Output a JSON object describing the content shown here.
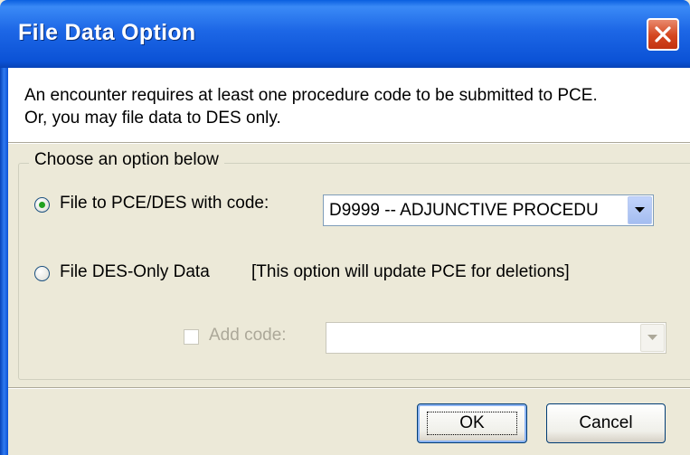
{
  "window": {
    "title": "File Data Option"
  },
  "message": {
    "line1": "An encounter requires at least one procedure code to be submitted to PCE.",
    "line2": "Or, you may file data to DES only."
  },
  "options_group": {
    "label": "Choose an option below",
    "option1": {
      "label": "File to PCE/DES with code:",
      "selected": true,
      "combo_value": "D9999 -- ADJUNCTIVE PROCEDU"
    },
    "option2": {
      "label": "File DES-Only Data",
      "note": "[This option will update PCE for deletions]",
      "selected": false
    },
    "add_code": {
      "label": "Add code:",
      "checked": false,
      "enabled": false,
      "combo_value": ""
    }
  },
  "buttons": {
    "ok": "OK",
    "cancel": "Cancel"
  },
  "colors": {
    "titlebar": "#0b52d6",
    "dialog_bg": "#ece9d8",
    "close_button": "#d4461f",
    "radio_dot": "#21a121"
  },
  "icons": {
    "close": "close-icon",
    "dropdown": "chevron-down-icon"
  }
}
